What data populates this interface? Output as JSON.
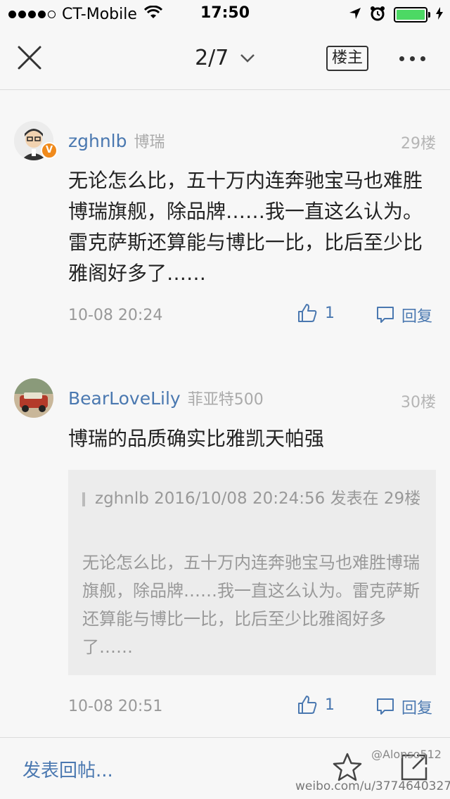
{
  "status_bar": {
    "carrier": "CT-Mobile",
    "time": "17:50",
    "signal_icon": "signal-dots-icon",
    "wifi_icon": "wifi-icon",
    "location_icon": "location-arrow-icon",
    "alarm_icon": "alarm-clock-icon",
    "battery_color": "#4cd964"
  },
  "nav": {
    "close_icon": "close-icon",
    "page_indicator": "2/7",
    "owner_button": "楼主",
    "more_icon": "more-icon"
  },
  "posts": [
    {
      "username": "zghnlb",
      "tag": "博瑞",
      "floor": "29楼",
      "verified_badge": "V",
      "content": "无论怎么比，五十万内连奔驰宝马也难胜博瑞旗舰，除品牌……我一直这么认为。雷克萨斯还算能与博比一比，比后至少比雅阁好多了……",
      "time": "10-08 20:24",
      "likes": "1",
      "reply_label": "回复"
    },
    {
      "username": "BearLoveLily",
      "tag": "菲亚特500",
      "floor": "30楼",
      "content": "博瑞的品质确实比雅凯天帕强",
      "quote": {
        "header": "zghnlb 2016/10/08 20:24:56 发表在 29楼",
        "body": "无论怎么比，五十万内连奔驰宝马也难胜博瑞旗舰，除品牌……我一直这么认为。雷克萨斯还算能与博比一比，比后至少比雅阁好多了……"
      },
      "time": "10-08 20:51",
      "likes": "1",
      "reply_label": "回复"
    }
  ],
  "bottom": {
    "compose_placeholder": "发表回帖...",
    "star_icon": "star-icon",
    "share_icon": "share-icon"
  },
  "watermark": {
    "handle": "@Alonso512",
    "url": "weibo.com/u/3774640327"
  },
  "colors": {
    "link_blue": "#4a78b0",
    "badge_orange": "#f08a1c"
  }
}
